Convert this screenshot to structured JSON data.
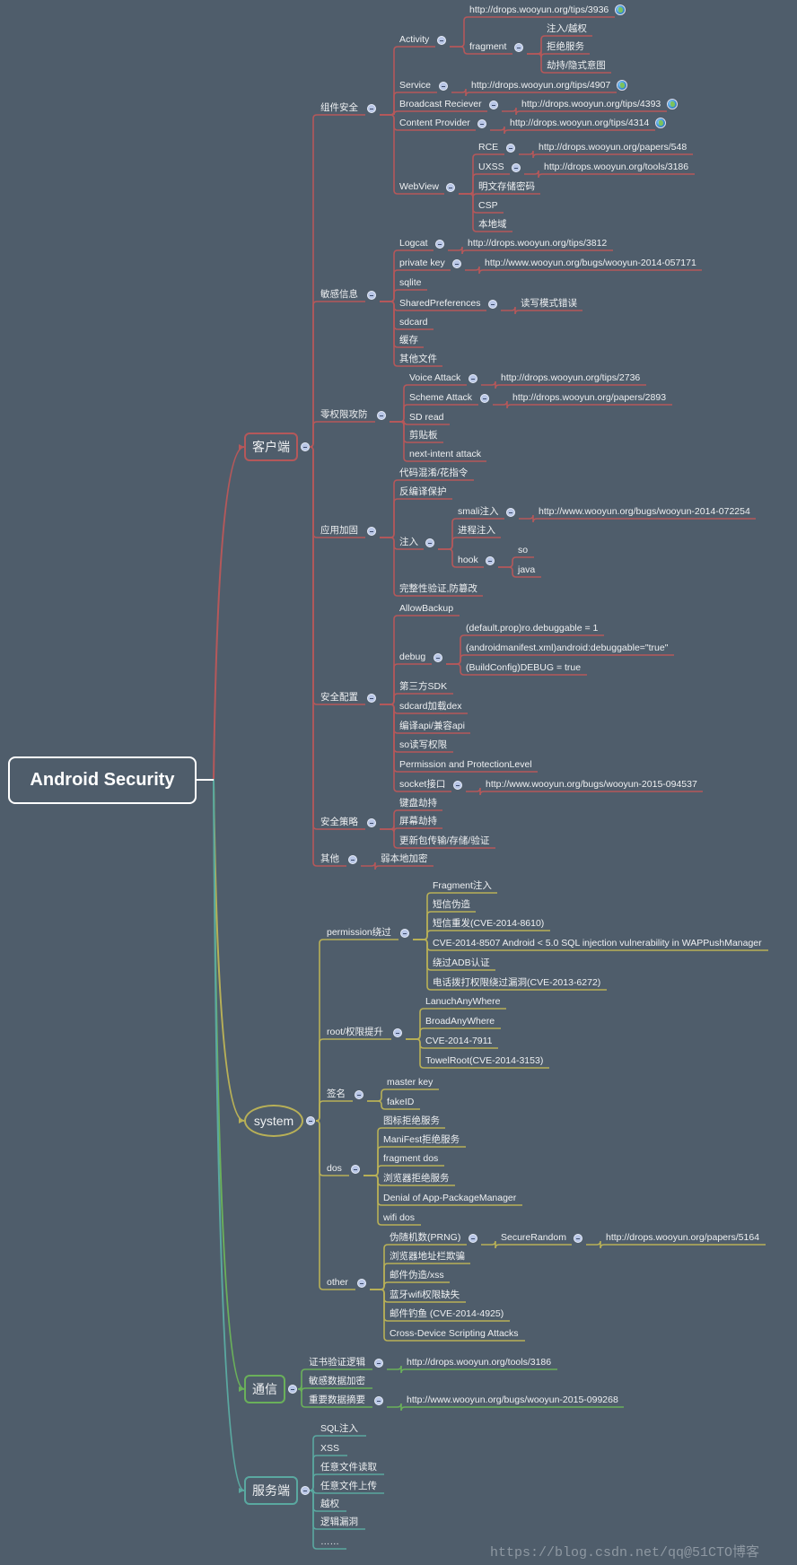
{
  "root": {
    "label": "Android Security"
  },
  "colors": {
    "background": "#4f5d6b",
    "client": "#b5585a",
    "system": "#b8b057",
    "comm": "#6ab05a",
    "server": "#5aa8a0",
    "text": "#eef0f2"
  },
  "branches": [
    {
      "key": "client",
      "label": "客户端",
      "shape": "rounded-rect",
      "children": [
        {
          "label": "组件安全",
          "children": [
            {
              "label": "Activity",
              "children": [
                {
                  "label": "http://drops.wooyun.org/tips/3936",
                  "icon": "globe-icon"
                },
                {
                  "label": "fragment",
                  "children": [
                    {
                      "label": "注入/越权"
                    },
                    {
                      "label": "拒绝服务"
                    },
                    {
                      "label": "劫持/隐式意图"
                    }
                  ]
                }
              ]
            },
            {
              "label": "Service",
              "children": [
                {
                  "label": "http://drops.wooyun.org/tips/4907",
                  "icon": "globe-icon"
                }
              ]
            },
            {
              "label": "Broadcast Reciever",
              "children": [
                {
                  "label": "http://drops.wooyun.org/tips/4393",
                  "icon": "globe-icon"
                }
              ]
            },
            {
              "label": "Content Provider",
              "children": [
                {
                  "label": "http://drops.wooyun.org/tips/4314",
                  "icon": "globe-icon"
                }
              ]
            },
            {
              "label": "WebView",
              "children": [
                {
                  "label": "RCE",
                  "children": [
                    {
                      "label": "http://drops.wooyun.org/papers/548"
                    }
                  ]
                },
                {
                  "label": "UXSS",
                  "children": [
                    {
                      "label": "http://drops.wooyun.org/tools/3186"
                    }
                  ]
                },
                {
                  "label": "明文存储密码"
                },
                {
                  "label": "CSP"
                },
                {
                  "label": "本地域"
                }
              ]
            }
          ]
        },
        {
          "label": "敏感信息",
          "children": [
            {
              "label": "Logcat",
              "children": [
                {
                  "label": "http://drops.wooyun.org/tips/3812"
                }
              ]
            },
            {
              "label": "private key",
              "children": [
                {
                  "label": "http://www.wooyun.org/bugs/wooyun-2014-057171"
                }
              ]
            },
            {
              "label": "sqlite"
            },
            {
              "label": "SharedPreferences",
              "children": [
                {
                  "label": "读写模式错误"
                }
              ]
            },
            {
              "label": "sdcard"
            },
            {
              "label": "缓存"
            },
            {
              "label": "其他文件"
            }
          ]
        },
        {
          "label": "零权限攻防",
          "children": [
            {
              "label": "Voice Attack",
              "children": [
                {
                  "label": "http://drops.wooyun.org/tips/2736"
                }
              ]
            },
            {
              "label": "Scheme Attack",
              "children": [
                {
                  "label": "http://drops.wooyun.org/papers/2893"
                }
              ]
            },
            {
              "label": "SD read"
            },
            {
              "label": "剪贴板"
            },
            {
              "label": "next-intent attack"
            }
          ]
        },
        {
          "label": "应用加固",
          "children": [
            {
              "label": "代码混淆/花指令"
            },
            {
              "label": "反编译保护"
            },
            {
              "label": "注入",
              "children": [
                {
                  "label": "smali注入",
                  "children": [
                    {
                      "label": "http://www.wooyun.org/bugs/wooyun-2014-072254"
                    }
                  ]
                },
                {
                  "label": "进程注入"
                },
                {
                  "label": "hook",
                  "children": [
                    {
                      "label": "so"
                    },
                    {
                      "label": "java"
                    }
                  ]
                }
              ]
            },
            {
              "label": "完整性验证,防篡改"
            }
          ]
        },
        {
          "label": "安全配置",
          "children": [
            {
              "label": "AllowBackup"
            },
            {
              "label": "debug",
              "children": [
                {
                  "label": "(default.prop)ro.debuggable = 1"
                },
                {
                  "label": "(androidmanifest.xml)android:debuggable=\"true\""
                },
                {
                  "label": "(BuildConfig)DEBUG = true"
                }
              ]
            },
            {
              "label": "第三方SDK"
            },
            {
              "label": "sdcard加载dex"
            },
            {
              "label": "编译api/兼容api"
            },
            {
              "label": "so读写权限"
            },
            {
              "label": "Permission and ProtectionLevel"
            },
            {
              "label": "socket接口",
              "children": [
                {
                  "label": "http://www.wooyun.org/bugs/wooyun-2015-094537"
                }
              ]
            }
          ]
        },
        {
          "label": "安全策略",
          "children": [
            {
              "label": "键盘劫持"
            },
            {
              "label": "屏幕劫持"
            },
            {
              "label": "更新包传输/存储/验证"
            }
          ]
        },
        {
          "label": "其他",
          "children": [
            {
              "label": "弱本地加密"
            }
          ]
        }
      ]
    },
    {
      "key": "system",
      "label": "system",
      "shape": "ellipse",
      "children": [
        {
          "label": "permission绕过",
          "children": [
            {
              "label": "Fragment注入"
            },
            {
              "label": "短信伪造"
            },
            {
              "label": "短信重发(CVE-2014-8610)"
            },
            {
              "label": "CVE-2014-8507 Android < 5.0 SQL injection vulnerability in WAPPushManager"
            },
            {
              "label": "绕过ADB认证"
            },
            {
              "label": "电话拨打权限绕过漏洞(CVE-2013-6272)"
            }
          ]
        },
        {
          "label": "root/权限提升",
          "children": [
            {
              "label": "LanuchAnyWhere"
            },
            {
              "label": "BroadAnyWhere"
            },
            {
              "label": "CVE-2014-7911"
            },
            {
              "label": "TowelRoot(CVE-2014-3153)"
            }
          ]
        },
        {
          "label": "签名",
          "children": [
            {
              "label": "master key"
            },
            {
              "label": "fakeID"
            }
          ]
        },
        {
          "label": "dos",
          "children": [
            {
              "label": "图标拒绝服务"
            },
            {
              "label": "ManiFest拒绝服务"
            },
            {
              "label": "fragment dos"
            },
            {
              "label": "浏览器拒绝服务"
            },
            {
              "label": "Denial of App-PackageManager"
            },
            {
              "label": "wifi dos"
            }
          ]
        },
        {
          "label": "other",
          "children": [
            {
              "label": "伪随机数(PRNG)",
              "children": [
                {
                  "label": "SecureRandom",
                  "children": [
                    {
                      "label": "http://drops.wooyun.org/papers/5164"
                    }
                  ]
                }
              ]
            },
            {
              "label": "浏览器地址栏欺骗"
            },
            {
              "label": "邮件伪造/xss"
            },
            {
              "label": "蓝牙wifi权限缺失"
            },
            {
              "label": "邮件钓鱼 (CVE-2014-4925)"
            },
            {
              "label": "Cross-Device Scripting Attacks"
            }
          ]
        }
      ]
    },
    {
      "key": "comm",
      "label": "通信",
      "shape": "rounded-rect",
      "children": [
        {
          "label": "证书验证逻辑",
          "children": [
            {
              "label": "http://drops.wooyun.org/tools/3186"
            }
          ]
        },
        {
          "label": "敏感数据加密"
        },
        {
          "label": "重要数据摘要",
          "children": [
            {
              "label": "http://www.wooyun.org/bugs/wooyun-2015-099268"
            }
          ]
        }
      ]
    },
    {
      "key": "server",
      "label": "服务端",
      "shape": "rounded-rect",
      "children": [
        {
          "label": "SQL注入"
        },
        {
          "label": "XSS"
        },
        {
          "label": "任意文件读取"
        },
        {
          "label": "任意文件上传"
        },
        {
          "label": "越权"
        },
        {
          "label": "逻辑漏洞"
        },
        {
          "label": "……"
        }
      ]
    }
  ],
  "watermark": "https://blog.csdn.net/qq@51CTO博客"
}
